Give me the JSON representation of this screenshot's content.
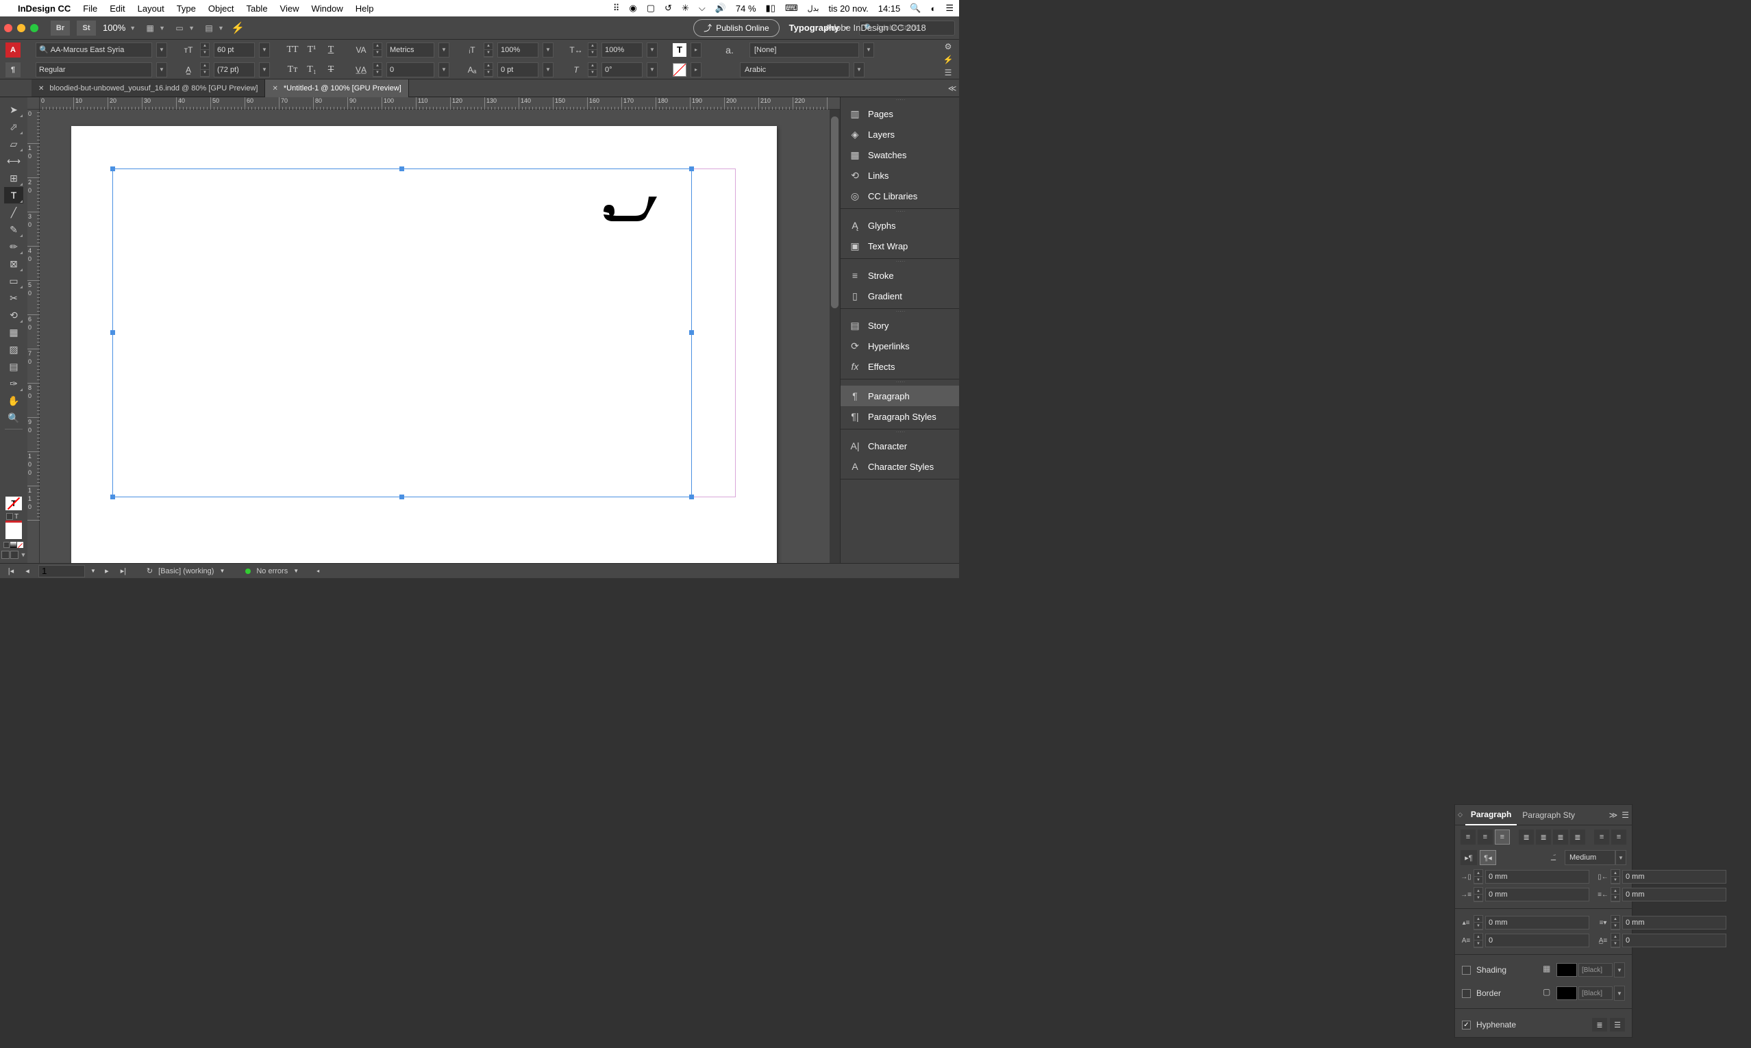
{
  "menubar": {
    "app_name": "InDesign CC",
    "items": [
      "File",
      "Edit",
      "Layout",
      "Type",
      "Object",
      "Table",
      "View",
      "Window",
      "Help"
    ],
    "right": {
      "battery": "74 %",
      "day": "tis 20 nov.",
      "time": "14:15",
      "arabic": "بدل"
    }
  },
  "appbar": {
    "br": "Br",
    "st": "St",
    "zoom": "100%",
    "doc_title": "Adobe InDesign CC 2018",
    "publish": "Publish Online",
    "workspace": "Typography",
    "search_placeholder": "Adobe Stock"
  },
  "controlbar": {
    "font": "AA-Marcus East Syria",
    "style": "Regular",
    "size": "60 pt",
    "leading": "(72 pt)",
    "kerning": "Metrics",
    "tracking": "0",
    "vscale": "100%",
    "hscale": "100%",
    "baseline": "0 pt",
    "skew": "0°",
    "char_style": "[None]",
    "language": "Arabic",
    "A_label": "A",
    "para_label": "¶",
    "a_dot": "a."
  },
  "tabs": [
    {
      "name": "bloodied-but-unbowed_yousuf_16.indd @ 80% [GPU Preview]",
      "active": false
    },
    {
      "name": "*Untitled-1 @ 100% [GPU Preview]",
      "active": true
    }
  ],
  "canvas": {
    "text": "ܫ"
  },
  "ruler_h": [
    "0",
    "10",
    "20",
    "30",
    "40",
    "50",
    "60",
    "70",
    "80",
    "90",
    "100",
    "110",
    "120",
    "130",
    "140",
    "150",
    "160",
    "170",
    "180",
    "190",
    "200",
    "210",
    "220"
  ],
  "ruler_v": [
    "0",
    "10",
    "20",
    "30",
    "40",
    "50",
    "60",
    "70",
    "80",
    "90",
    "100",
    "110"
  ],
  "right_rail": {
    "g1": [
      "Pages",
      "Layers",
      "Swatches",
      "Links",
      "CC Libraries"
    ],
    "g2": [
      "Glyphs",
      "Text Wrap"
    ],
    "g3": [
      "Stroke",
      "Gradient"
    ],
    "g4": [
      "Story",
      "Hyperlinks",
      "Effects"
    ],
    "g5": [
      "Paragraph",
      "Paragraph Styles"
    ],
    "g6": [
      "Character",
      "Character Styles"
    ]
  },
  "para_panel": {
    "tab1": "Paragraph",
    "tab2": "Paragraph Sty",
    "kashida": "Medium",
    "indents": {
      "left": "0 mm",
      "right": "0 mm",
      "first": "0 mm",
      "last": "0 mm",
      "before": "0 mm",
      "after": "0 mm",
      "dropcap_lines": "0",
      "dropcap_chars": "0"
    },
    "shading": "Shading",
    "shading_color": "[Black]",
    "border": "Border",
    "border_color": "[Black]",
    "hyphenate": "Hyphenate"
  },
  "statusbar": {
    "page": "1",
    "master": "[Basic] (working)",
    "errors": "No errors"
  }
}
